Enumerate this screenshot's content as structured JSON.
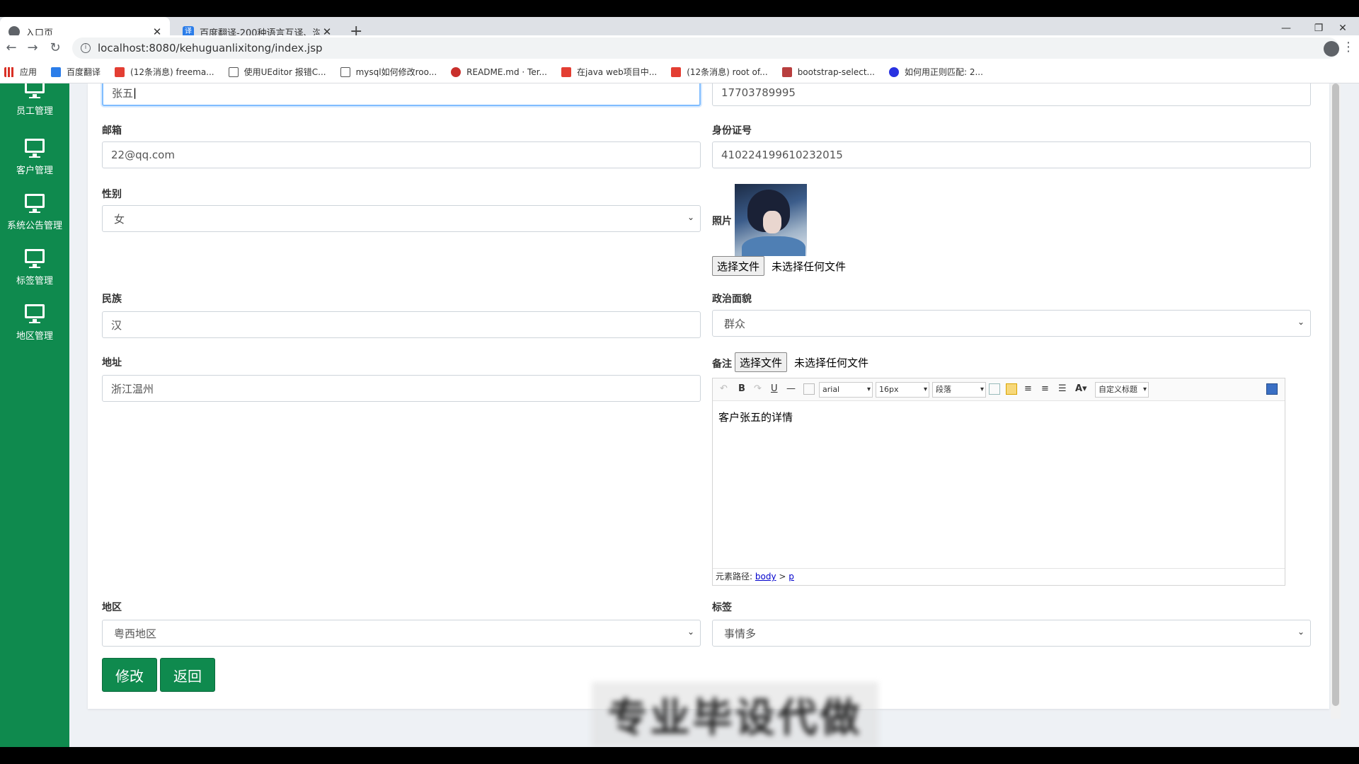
{
  "browser": {
    "tabs": [
      {
        "title": "入口页",
        "close": "✕"
      },
      {
        "title": "百度翻译-200种语言互译、沟通…",
        "close": "✕"
      }
    ],
    "new_tab": "+",
    "window_controls": [
      "—",
      "❐",
      "✕"
    ],
    "url": "localhost:8080/kehuguanlixitong/index.jsp",
    "bookmarks": [
      {
        "label": "应用",
        "icon": "apps-icon"
      },
      {
        "label": "百度翻译",
        "icon": "baidu-translate-icon"
      },
      {
        "label": "(12条消息) freema...",
        "icon": "csdn-icon"
      },
      {
        "label": "使用UEditor 报错C...",
        "icon": "ueditor-icon"
      },
      {
        "label": "mysql如何修改roo...",
        "icon": "ueditor-icon"
      },
      {
        "label": "README.md · Ter...",
        "icon": "gitee-icon"
      },
      {
        "label": "在java web项目中...",
        "icon": "csdn-icon"
      },
      {
        "label": "(12条消息) root of...",
        "icon": "csdn-icon"
      },
      {
        "label": "bootstrap-select...",
        "icon": "bootstrap-icon"
      },
      {
        "label": "如何用正则匹配: 2...",
        "icon": "baidu-paw-icon"
      }
    ]
  },
  "sidebar": {
    "items": [
      {
        "label": "员工管理"
      },
      {
        "label": "客户管理"
      },
      {
        "label": "系统公告管理"
      },
      {
        "label": "标签管理"
      },
      {
        "label": "地区管理"
      }
    ]
  },
  "form": {
    "name_value": "张五",
    "phone_value": "17703789995",
    "email_label": "邮箱",
    "email_value": "22@qq.com",
    "idcard_label": "身份证号",
    "idcard_value": "410224199610232015",
    "gender_label": "性别",
    "gender_value": "女",
    "photo_label": "照片",
    "file_button": "选择文件",
    "file_none": "未选择任何文件",
    "ethnic_label": "民族",
    "ethnic_value": "汉",
    "political_label": "政治面貌",
    "political_value": "群众",
    "address_label": "地址",
    "address_value": "浙江温州",
    "remark_label": "备注",
    "region_label": "地区",
    "region_value": "粤西地区",
    "tag_label": "标签",
    "tag_value": "事情多",
    "submit_label": "修改",
    "back_label": "返回"
  },
  "editor": {
    "font_family": "arial",
    "font_size": "16px",
    "paragraph": "段落",
    "custom_title": "自定义标题",
    "content": "客户张五的详情",
    "path_label": "元素路径:",
    "path_body": "body",
    "path_sep": ">",
    "path_p": "p"
  },
  "watermark": "专业毕设代做",
  "colors": {
    "accent": "#0f8a4e",
    "focus_border": "#80bdff"
  }
}
